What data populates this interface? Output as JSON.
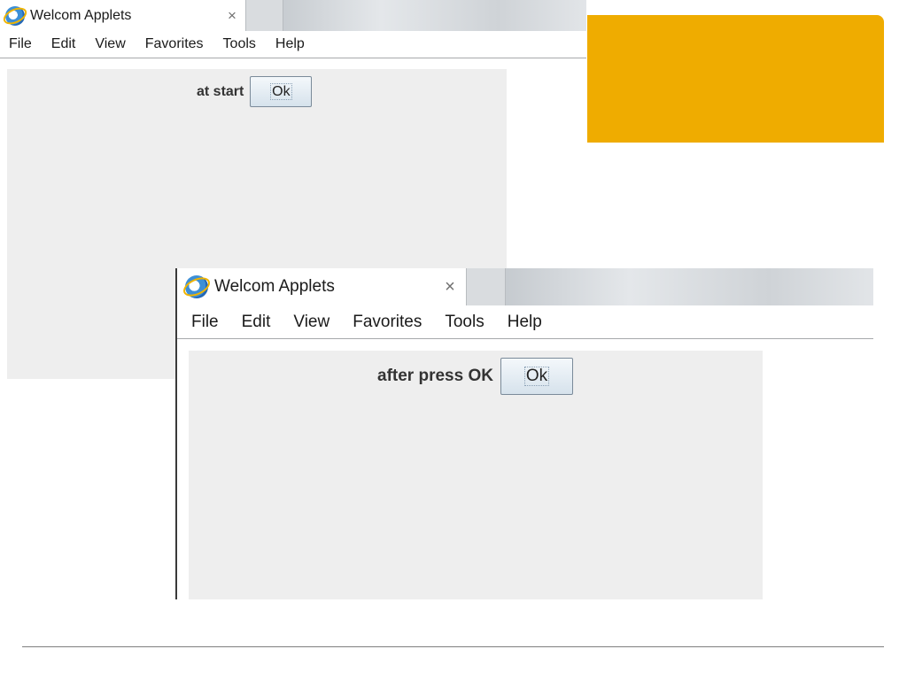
{
  "accent_color": "#EFAC00",
  "window_start": {
    "tab": {
      "icon": "internet-explorer-icon",
      "title": "Welcom Applets",
      "close_glyph": "×"
    },
    "menu": [
      "File",
      "Edit",
      "View",
      "Favorites",
      "Tools",
      "Help"
    ],
    "applet": {
      "label": "at start",
      "button_label": "Ok"
    }
  },
  "window_after": {
    "tab": {
      "icon": "internet-explorer-icon",
      "title": "Welcom Applets",
      "close_glyph": "×"
    },
    "menu": [
      "File",
      "Edit",
      "View",
      "Favorites",
      "Tools",
      "Help"
    ],
    "applet": {
      "label": "after press OK",
      "button_label": "Ok"
    }
  }
}
